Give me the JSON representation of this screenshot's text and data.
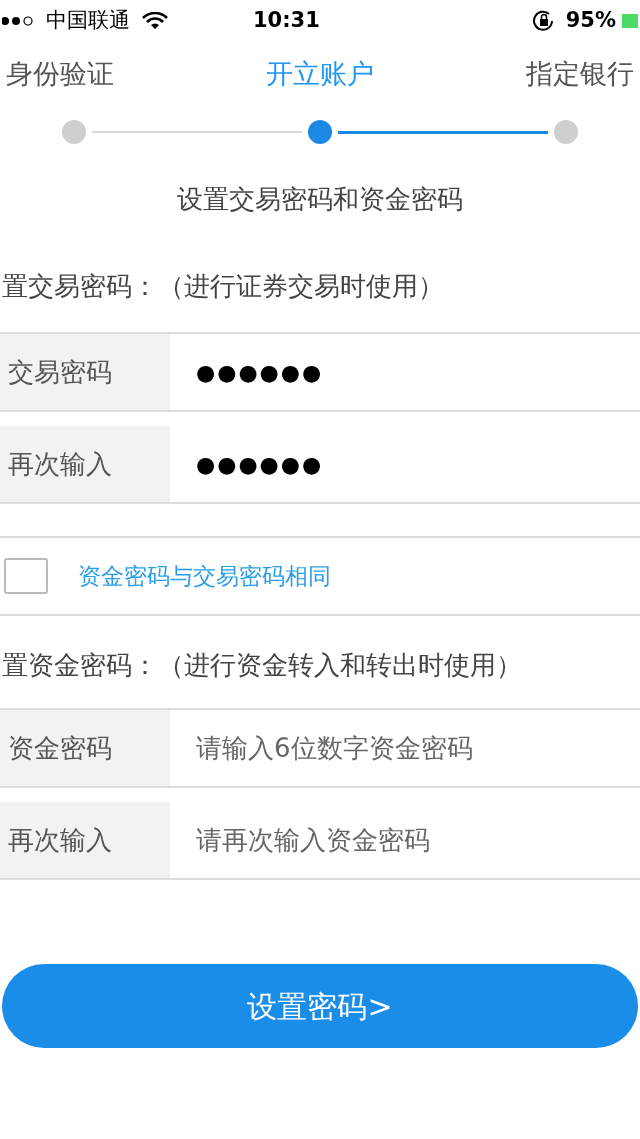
{
  "status_bar": {
    "carrier": "中国联通",
    "time": "10:31",
    "battery": "95%"
  },
  "steps": [
    {
      "label": "身份验证",
      "selected": false
    },
    {
      "label": "开立账户",
      "selected": true
    },
    {
      "label": "指定银行",
      "selected": false
    }
  ],
  "subtitle": "设置交易密码和资金密码",
  "trade_section": {
    "label": "置交易密码：（进行证券交易时使用）",
    "fields": [
      {
        "label": "交易密码",
        "value": "●●●●●●"
      },
      {
        "label": "再次输入",
        "value": "●●●●●●"
      }
    ]
  },
  "same_password": {
    "label": "资金密码与交易密码相同",
    "checked": false
  },
  "fund_section": {
    "label": "置资金密码：（进行资金转入和转出时使用）",
    "fields": [
      {
        "label": "资金密码",
        "placeholder": "请输入6位数字资金密码"
      },
      {
        "label": "再次输入",
        "placeholder": "请再次输入资金密码"
      }
    ]
  },
  "submit": "设置密码>"
}
